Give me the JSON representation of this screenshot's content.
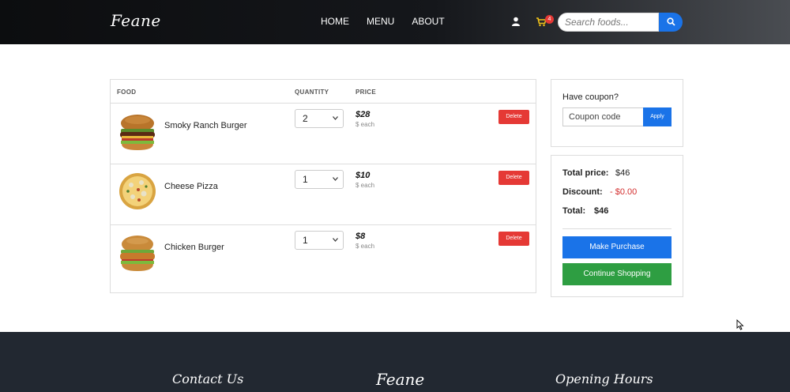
{
  "header": {
    "brand": "Feane",
    "nav": [
      "HOME",
      "MENU",
      "ABOUT"
    ],
    "cart_count": "4",
    "search_placeholder": "Search foods..."
  },
  "cart": {
    "columns": {
      "food": "FOOD",
      "quantity": "QUANTITY",
      "price": "PRICE"
    },
    "items": [
      {
        "name": "Smoky Ranch Burger",
        "quantity": "2",
        "price": "$28",
        "each": "$ each",
        "delete": "Delete"
      },
      {
        "name": "Cheese Pizza",
        "quantity": "1",
        "price": "$10",
        "each": "$ each",
        "delete": "Delete"
      },
      {
        "name": "Chicken Burger",
        "quantity": "1",
        "price": "$8",
        "each": "$ each",
        "delete": "Delete"
      }
    ]
  },
  "coupon": {
    "label": "Have coupon?",
    "placeholder": "Coupon code",
    "apply": "Apply"
  },
  "summary": {
    "total_price_label": "Total price:",
    "total_price": "$46",
    "discount_label": "Discount:",
    "discount": "- $0.00",
    "total_label": "Total:",
    "total": "$46",
    "purchase": "Make Purchase",
    "continue": "Continue Shopping"
  },
  "footer": {
    "contact": "Contact Us",
    "brand": "Feane",
    "hours": "Opening Hours"
  },
  "colors": {
    "primary": "#1a73e8",
    "success": "#2e9e42",
    "danger": "#e53935",
    "footer_bg": "#222831"
  }
}
